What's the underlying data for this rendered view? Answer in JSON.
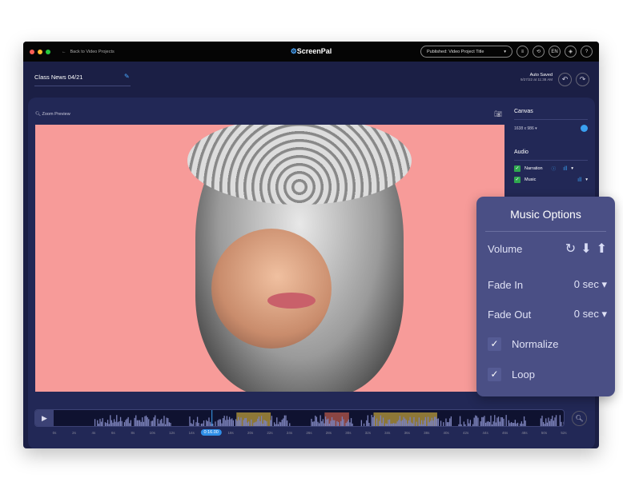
{
  "topbar": {
    "back_label": "Back to Video Projects",
    "logo": "ScreenPal",
    "publish_select": "Published: Video Project Title",
    "lang": "EN"
  },
  "header": {
    "project_title": "Class News 04/21",
    "auto_saved": "Auto Saved",
    "saved_time": "9/27/22 at 11:38 AM"
  },
  "preview": {
    "zoom_label": "Zoom Preview"
  },
  "sidebar": {
    "canvas_heading": "Canvas",
    "resolution": "1638 x 986",
    "canvas_color": "#3aa0f0",
    "audio_heading": "Audio",
    "tracks": [
      {
        "label": "Narration",
        "checked": true
      },
      {
        "label": "Music",
        "checked": true
      }
    ]
  },
  "timeline": {
    "current_time": "0:16.00",
    "current_seconds": 16,
    "ticks": [
      "0s",
      "2s",
      "4s",
      "6s",
      "8s",
      "10s",
      "12s",
      "14s",
      "16s",
      "18s",
      "20s",
      "22s",
      "24s",
      "26s",
      "28s",
      "30s",
      "32s",
      "34s",
      "36s",
      "38s",
      "40s",
      "42s",
      "44s",
      "46s",
      "48s",
      "50s",
      "52s"
    ],
    "segments": [
      {
        "start": 18.5,
        "end": 22,
        "color": "#b89a3a"
      },
      {
        "start": 27.5,
        "end": 30,
        "color": "#b4574a"
      },
      {
        "start": 32.5,
        "end": 39,
        "color": "#b89a3a"
      }
    ]
  },
  "music_options": {
    "title": "Music Options",
    "volume_label": "Volume",
    "fade_in_label": "Fade In",
    "fade_in_value": "0 sec",
    "fade_out_label": "Fade Out",
    "fade_out_value": "0 sec",
    "normalize_label": "Normalize",
    "normalize_checked": true,
    "loop_label": "Loop",
    "loop_checked": true
  }
}
